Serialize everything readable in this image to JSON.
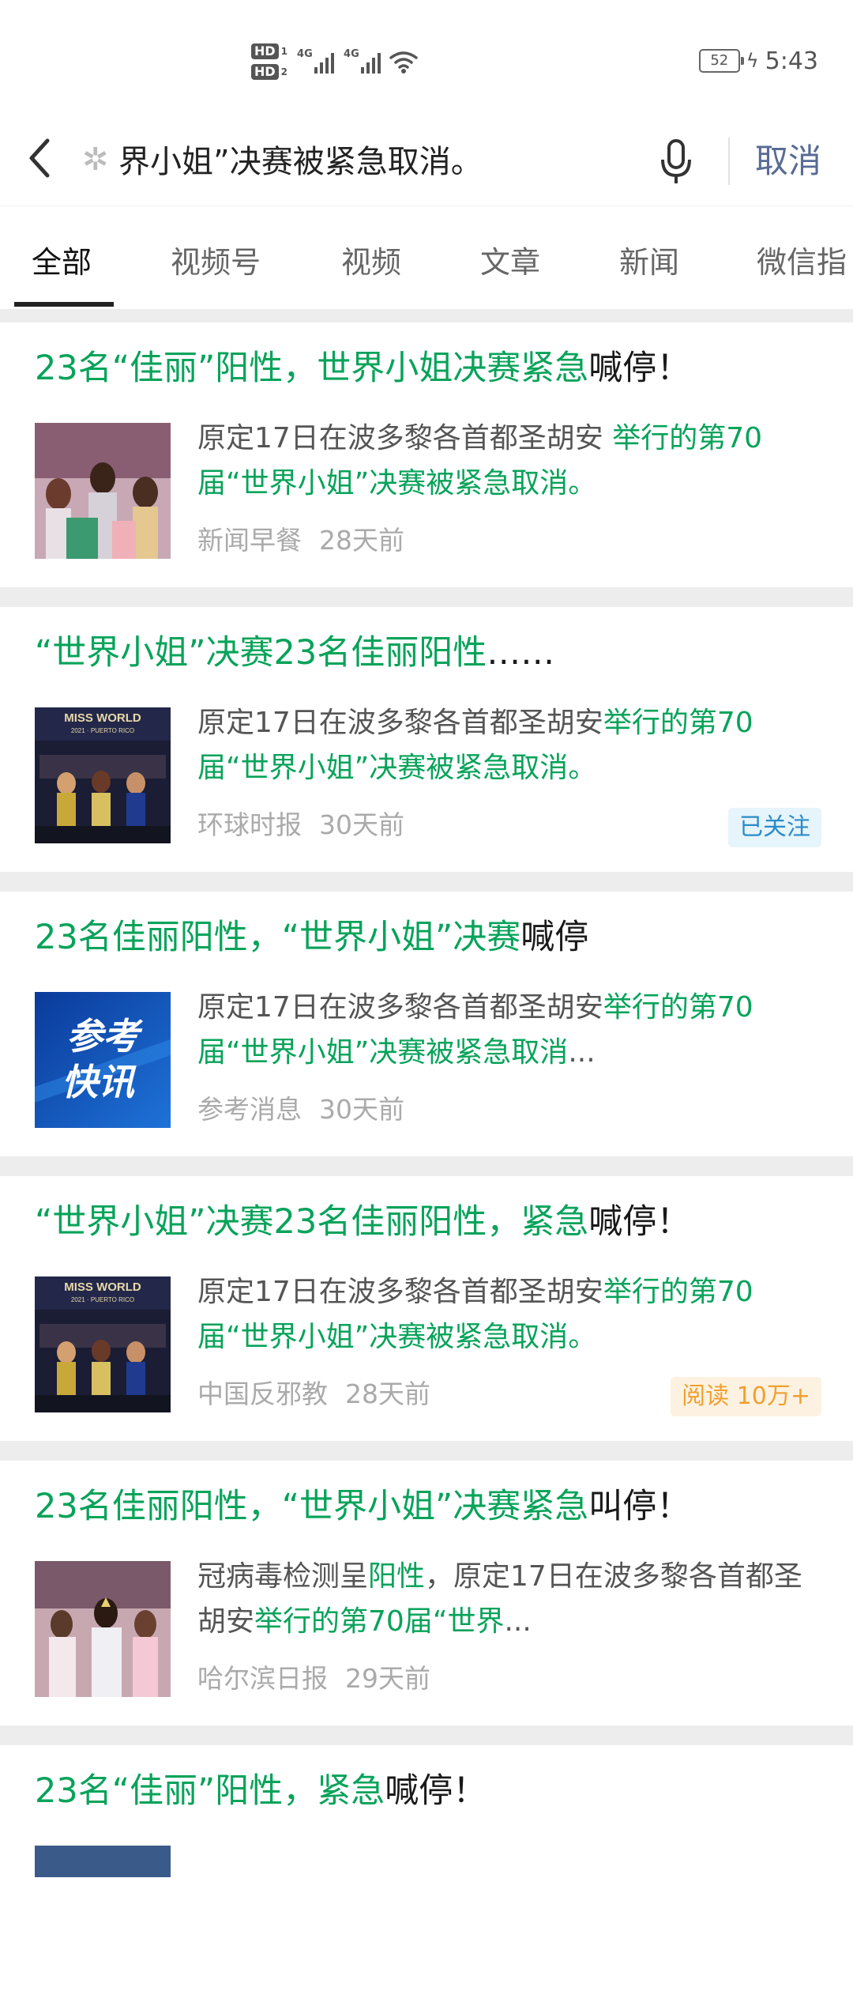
{
  "status_bar": {
    "hd1": "HD",
    "hd1_num": "1",
    "hd2": "HD",
    "hd2_num": "2",
    "net1": "4G",
    "net2": "4G",
    "battery": "52",
    "time": "5:43"
  },
  "search": {
    "query": "界小姐”决赛被紧急取消。",
    "cancel_label": "取消"
  },
  "tabs": [
    {
      "label": "全部",
      "active": true
    },
    {
      "label": "视频号"
    },
    {
      "label": "视频"
    },
    {
      "label": "文章"
    },
    {
      "label": "新闻"
    },
    {
      "label": "微信指"
    }
  ],
  "results": [
    {
      "title": [
        {
          "t": "23名“佳丽”阳性，世界小姐决赛紧急",
          "hl": true
        },
        {
          "t": "喊停！",
          "hl": false
        }
      ],
      "desc": [
        {
          "t": "原定17日在波多黎各首都圣胡安 ",
          "hl": false
        },
        {
          "t": "举行的第70届“世界小姐”决赛被紧急取消。",
          "hl": true
        }
      ],
      "source": "新闻早餐",
      "time": "28天前",
      "badge": null
    },
    {
      "title": [
        {
          "t": "“世界小姐”决赛23名佳丽阳性",
          "hl": true
        },
        {
          "t": "……",
          "hl": false
        }
      ],
      "desc": [
        {
          "t": "原定17日在波多黎各首都圣胡安",
          "hl": false
        },
        {
          "t": "举行的第70届“世界小姐”决赛被紧急取消。",
          "hl": true
        }
      ],
      "source": "环球时报",
      "time": "30天前",
      "badge": {
        "text": "已关注",
        "kind": "follow"
      }
    },
    {
      "title": [
        {
          "t": "23名佳丽阳性，“世界小姐”决赛",
          "hl": true
        },
        {
          "t": "喊停",
          "hl": false
        }
      ],
      "desc": [
        {
          "t": "原定17日在波多黎各首都圣胡安",
          "hl": false
        },
        {
          "t": "举行的第70届“世界小姐”决赛被紧急取消",
          "hl": true
        },
        {
          "t": "...",
          "hl": false
        }
      ],
      "source": "参考消息",
      "time": "30天前",
      "badge": null
    },
    {
      "title": [
        {
          "t": "“世界小姐”决赛23名佳丽阳性，紧急",
          "hl": true
        },
        {
          "t": "喊停！",
          "hl": false
        }
      ],
      "desc": [
        {
          "t": "原定17日在波多黎各首都圣胡安",
          "hl": false
        },
        {
          "t": "举行的第70届“世界小姐”决赛被紧急取消。",
          "hl": true
        }
      ],
      "source": "中国反邪教",
      "time": "28天前",
      "badge": {
        "text": "阅读 10万+",
        "kind": "reads"
      }
    },
    {
      "title": [
        {
          "t": "23名佳丽阳性，“世界小姐”决赛紧急",
          "hl": true
        },
        {
          "t": "叫停！",
          "hl": false
        }
      ],
      "desc": [
        {
          "t": "冠病毒检测呈",
          "hl": false
        },
        {
          "t": "阳性",
          "hl": true
        },
        {
          "t": "，原定17日在波多黎各首都圣胡安",
          "hl": false
        },
        {
          "t": "举行的第70届“世界",
          "hl": true
        },
        {
          "t": "...",
          "hl": false
        }
      ],
      "source": "哈尔滨日报",
      "time": "29天前",
      "badge": null
    },
    {
      "title": [
        {
          "t": "23名“佳丽”阳性，紧急",
          "hl": true
        },
        {
          "t": "喊停！",
          "hl": false
        }
      ],
      "desc": [],
      "source": "",
      "time": "",
      "badge": null
    }
  ],
  "thumbs": {
    "misswrld_caption": "MISS WORLD",
    "misswrld_sub": "2021 · PUERTO RICO",
    "cankao_line1": "参考",
    "cankao_line2": "快讯"
  },
  "colors": {
    "highlight": "#07a35a",
    "link_blue": "#576b95"
  }
}
